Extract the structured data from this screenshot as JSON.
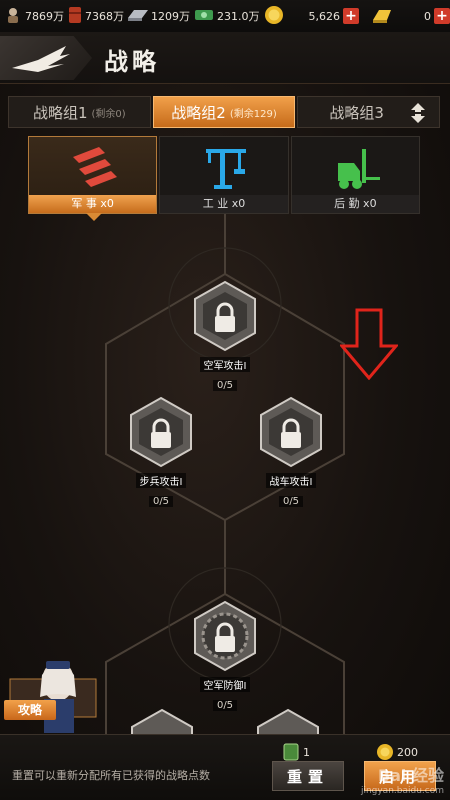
{
  "resources": [
    {
      "icon": "soldier-icon",
      "value": "7869万"
    },
    {
      "icon": "oil-barrel-icon",
      "value": "7368万"
    },
    {
      "icon": "steel-icon",
      "value": "1209万"
    },
    {
      "icon": "cash-icon",
      "value": "231.0万"
    },
    {
      "icon": "gold-coin-icon",
      "value": "5,626"
    },
    {
      "icon": "gold-bar-icon",
      "value": "0"
    }
  ],
  "header": {
    "title": "战略"
  },
  "tabs": [
    {
      "label": "战略组1",
      "remaining": "(剩余0)",
      "active": false
    },
    {
      "label": "战略组2",
      "remaining": "(剩余129)",
      "active": true
    },
    {
      "label": "战略组3",
      "remaining": "",
      "active": false
    }
  ],
  "categories": [
    {
      "label": "军 事 x0",
      "icon": "missile-icon",
      "active": true
    },
    {
      "label": "工 业 x0",
      "icon": "crane-icon",
      "active": false
    },
    {
      "label": "后 勤 x0",
      "icon": "forklift-icon",
      "active": false
    }
  ],
  "nodes": [
    {
      "name": "空军攻击I",
      "progress": "0/5"
    },
    {
      "name": "步兵攻击I",
      "progress": "0/5"
    },
    {
      "name": "战车攻击I",
      "progress": "0/5"
    },
    {
      "name": "空军防御I",
      "progress": "0/5"
    }
  ],
  "guide": {
    "label": "攻略"
  },
  "bottom": {
    "tip": "重置可以重新分配所有已获得的战略点数",
    "reset_cost": "1",
    "apply_cost": "200",
    "reset_label": "重置",
    "apply_label": "启用"
  },
  "watermark": {
    "brand": "Bai 经验",
    "url": "jingyan.baidu.com"
  },
  "colors": {
    "accent": "#e58a33",
    "arrow": "#e0241b"
  }
}
